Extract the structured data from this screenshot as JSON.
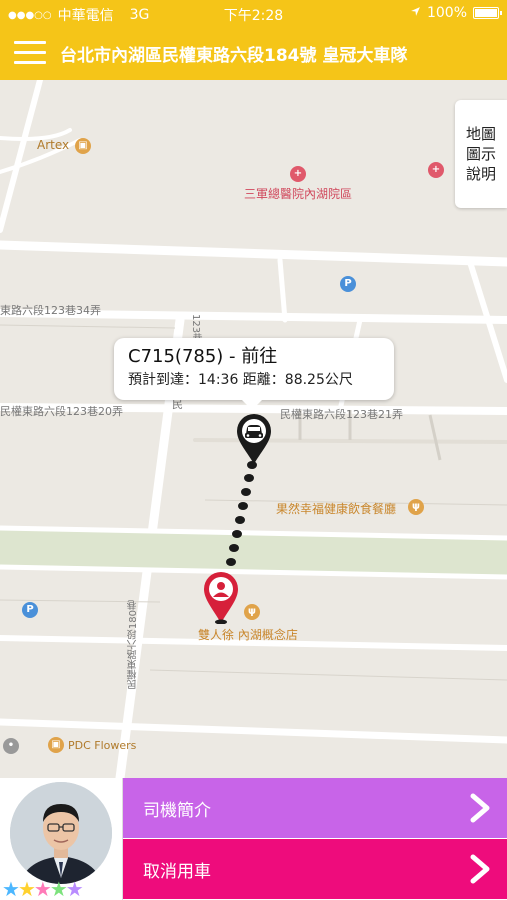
{
  "status_bar": {
    "carrier": "中華電信",
    "network": "3G",
    "time": "下午2:28",
    "battery": "100%"
  },
  "nav": {
    "title": "台北市內湖區民權東路六段184號 皇冠大車隊"
  },
  "map": {
    "legend_button": [
      "地圖",
      "圖示",
      "說明"
    ],
    "road_labels": {
      "lane34": "東路六段123巷34弄",
      "lane20": "民權東路六段123巷20弄",
      "lane21": "民權東路六段123巷21弄",
      "lane123": "123巷",
      "lane180": "民權東路六段180巷",
      "min": "民"
    },
    "pois": {
      "artex": "Artex",
      "hospital": "三軍總醫院內湖院區",
      "restaurant": "果然幸福健康飲食餐廳",
      "shop": "雙人徐 內湖概念店",
      "flowers": "PDC Flowers"
    },
    "info_bubble": {
      "title": "C715(785) - 前往",
      "subtitle": "預計到達：14:36 距離：88.25公尺"
    }
  },
  "bottom_panel": {
    "driver_intro": "司機簡介",
    "cancel": "取消用車"
  },
  "colors": {
    "brand_yellow": "#f5c518",
    "driver_button": "#c864e8",
    "cancel_button": "#ee0c7c"
  }
}
